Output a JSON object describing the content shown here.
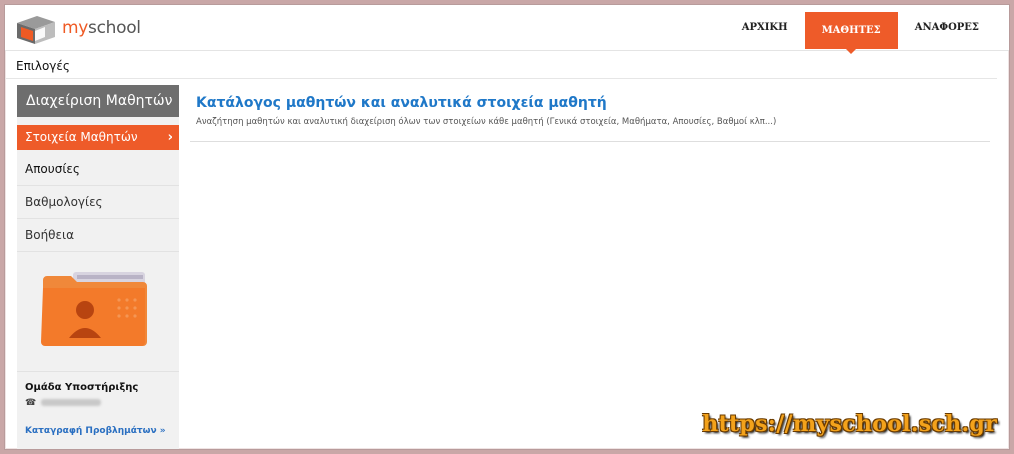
{
  "header": {
    "logo_text_my": "my",
    "logo_text_school": "school",
    "nav": [
      {
        "label": "ΑΡΧΙΚΗ"
      },
      {
        "label": "ΜΑΘΗΤΕΣ",
        "active": true
      },
      {
        "label": "ΑΝΑΦΟΡΕΣ"
      }
    ]
  },
  "options": {
    "label": "Επιλογές"
  },
  "sidebar": {
    "title": "Διαχείριση Μαθητών",
    "items": [
      {
        "label": "Στοιχεία Μαθητών",
        "active": true
      },
      {
        "label": "Απουσίες"
      },
      {
        "label": "Βαθμολογίες"
      },
      {
        "label": "Βοήθεια"
      }
    ],
    "support_title": "Ομάδα Υποστήριξης",
    "support_link": "Καταγραφή Προβλημάτων »"
  },
  "main": {
    "title": "Κατάλογος μαθητών και αναλυτικά στοιχεία μαθητή",
    "subtitle": "Αναζήτηση μαθητών και αναλυτική διαχείριση όλων των στοιχείων κάθε μαθητή (Γενικά στοιχεία, Μαθήματα, Απουσίες, Βαθμοί κλπ...)"
  },
  "watermark": "https://myschool.sch.gr",
  "colors": {
    "accent": "#ee5b29",
    "link": "#2a6fc1",
    "title": "#1f78c8"
  }
}
